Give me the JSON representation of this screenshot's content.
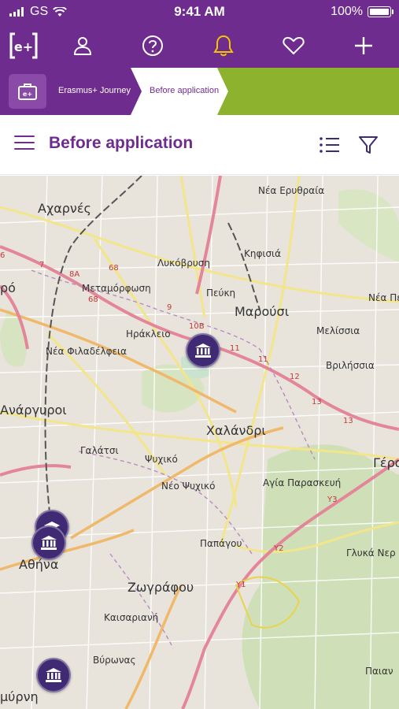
{
  "status_bar": {
    "carrier": "GS",
    "time": "9:41 AM",
    "battery": "100%"
  },
  "nav": {
    "logo_text": "e+",
    "icons": [
      "profile-icon",
      "help-icon",
      "bell-icon",
      "heart-icon",
      "plus-icon"
    ],
    "accent": "#6f2c8f",
    "bell_color": "#f2c500"
  },
  "breadcrumb": {
    "home_label": "Erasmus+ Journey",
    "current_label": "Before application",
    "progress_color": "#8cb22e"
  },
  "header": {
    "title": "Before application"
  },
  "map": {
    "labels": [
      {
        "text": "Νέα Ερυθραία"
      },
      {
        "text": "Αχαρνές"
      },
      {
        "text": "Λυκόβρυση"
      },
      {
        "text": "Κηφισιά"
      },
      {
        "text": "Μεταμόρφωση"
      },
      {
        "text": "Πεύκη"
      },
      {
        "text": "Νέα Πε"
      },
      {
        "text": "Ηράκλειο"
      },
      {
        "text": "Μαρούσι"
      },
      {
        "text": "Μελίσσια"
      },
      {
        "text": "Νέα Φιλαδέλφεια"
      },
      {
        "text": "Βριλήσσια"
      },
      {
        "text": "Ανάργυροι"
      },
      {
        "text": "Χαλάνδρι"
      },
      {
        "text": "Γαλάτσι"
      },
      {
        "text": "Ψυχικό"
      },
      {
        "text": "Γέρα"
      },
      {
        "text": "Νέο Ψυχικό"
      },
      {
        "text": "Αγία Παρασκευή"
      },
      {
        "text": "Παπάγου"
      },
      {
        "text": "Γλυκά Νερ"
      },
      {
        "text": "Αθήνα"
      },
      {
        "text": "Ζωγράφου"
      },
      {
        "text": "Καισαριανή"
      },
      {
        "text": "Βύρωνας"
      },
      {
        "text": "Παιαν"
      },
      {
        "text": "ρό"
      },
      {
        "text": "μύρνη"
      }
    ],
    "road_numbers": [
      "68",
      "8A",
      "68",
      "9",
      "10B",
      "11",
      "11",
      "12",
      "13",
      "13",
      "Y3",
      "Y2",
      "Y1",
      "7",
      "6"
    ],
    "markers": [
      {
        "type": "institution"
      },
      {
        "type": "graduation"
      },
      {
        "type": "institution"
      },
      {
        "type": "institution"
      }
    ]
  }
}
